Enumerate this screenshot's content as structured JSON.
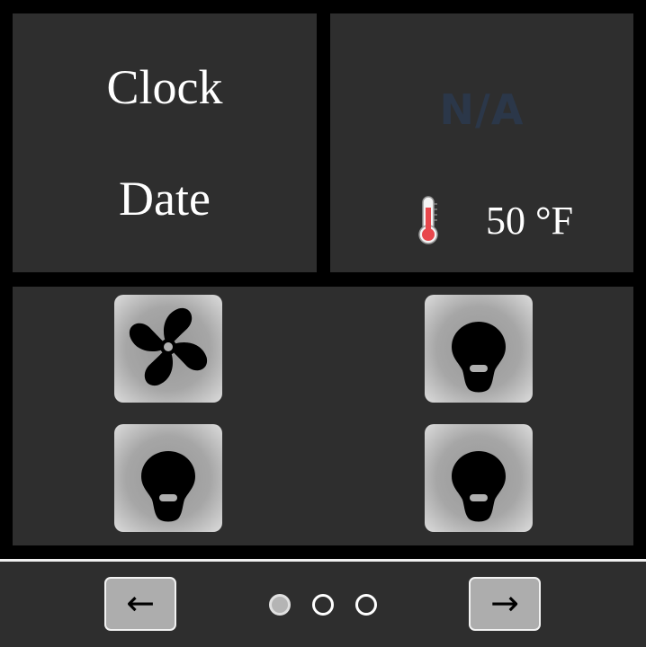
{
  "clock": {
    "time_label": "Clock",
    "date_label": "Date"
  },
  "weather": {
    "status": "N/A",
    "temperature": "50 °F",
    "icon": "thermometer-icon"
  },
  "controls": {
    "tiles": [
      {
        "icon": "fan-icon"
      },
      {
        "icon": "light-bulb-icon"
      },
      {
        "icon": "light-bulb-icon"
      },
      {
        "icon": "light-bulb-icon"
      }
    ]
  },
  "footer": {
    "prev_label": "←",
    "next_label": "→",
    "pages": 3,
    "active_page": 1
  },
  "colors": {
    "panel": "#2e2e2e",
    "background": "#000000",
    "status_text": "#2b3749",
    "thermometer": "#e8474c"
  }
}
